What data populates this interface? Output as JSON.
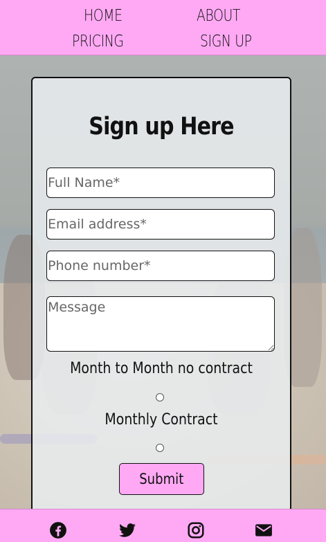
{
  "nav": {
    "items": [
      {
        "label": "HOME"
      },
      {
        "label": "ABOUT"
      },
      {
        "label": "PRICING"
      },
      {
        "label": "SIGN UP"
      }
    ]
  },
  "form": {
    "title": "Sign up Here",
    "full_name_placeholder": "Full Name*",
    "email_placeholder": "Email address*",
    "phone_placeholder": "Phone number*",
    "message_placeholder": "Message",
    "option_monthly_no_contract": "Month to Month no contract",
    "option_monthly_contract": "Monthly Contract",
    "submit_label": "Submit"
  },
  "footer": {
    "social_icons": [
      "facebook-icon",
      "twitter-icon",
      "instagram-icon",
      "envelope-icon"
    ]
  },
  "colors": {
    "accent_pink": "#ffa9f4",
    "text": "#111111",
    "card_bg": "#e9ecef"
  }
}
